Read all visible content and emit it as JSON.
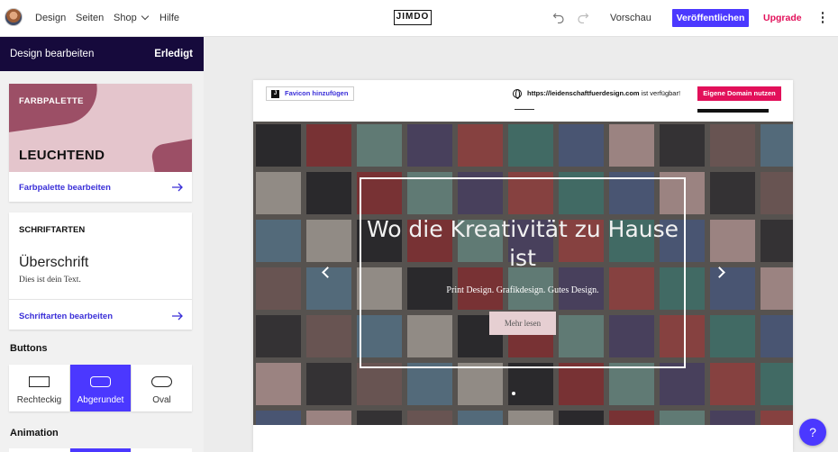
{
  "topbar": {
    "nav": [
      "Design",
      "Seiten",
      "Shop",
      "Hilfe"
    ],
    "logo": "JIMDO",
    "preview": "Vorschau",
    "publish": "Veröffentlichen",
    "upgrade": "Upgrade"
  },
  "sidebar": {
    "title": "Design bearbeiten",
    "done": "Erledigt",
    "palette": {
      "label": "FARBPALETTE",
      "name": "LEUCHTEND",
      "link": "Farbpalette bearbeiten"
    },
    "fonts": {
      "label": "SCHRIFTARTEN",
      "heading": "Überschrift",
      "body": "Dies ist dein Text.",
      "link": "Schriftarten bearbeiten"
    },
    "buttons": {
      "title": "Buttons",
      "options": [
        "Rechteckig",
        "Abgerundet",
        "Oval"
      ],
      "selected": "Abgerundet"
    },
    "animation": {
      "title": "Animation"
    }
  },
  "preview": {
    "favicon": "Favicon hinzufügen",
    "favicon_icon": "J",
    "domain_url": "https://leidenschaftfuerdesign.com",
    "domain_status": "ist verfügbar!",
    "own_domain": "Eigene Domain nutzen",
    "hero": {
      "title": "Wo die Kreativität zu Hause ist",
      "subtitle": "Print Design. Grafikdesign. Gutes Design.",
      "cta": "Mehr lesen"
    }
  },
  "help": "?",
  "colors": {
    "accent": "#4b38ff",
    "pink": "#e2105a",
    "sidebar_header": "#160a3c",
    "palette_bg": "#e4c5cc",
    "palette_shape": "#9c4f66"
  }
}
